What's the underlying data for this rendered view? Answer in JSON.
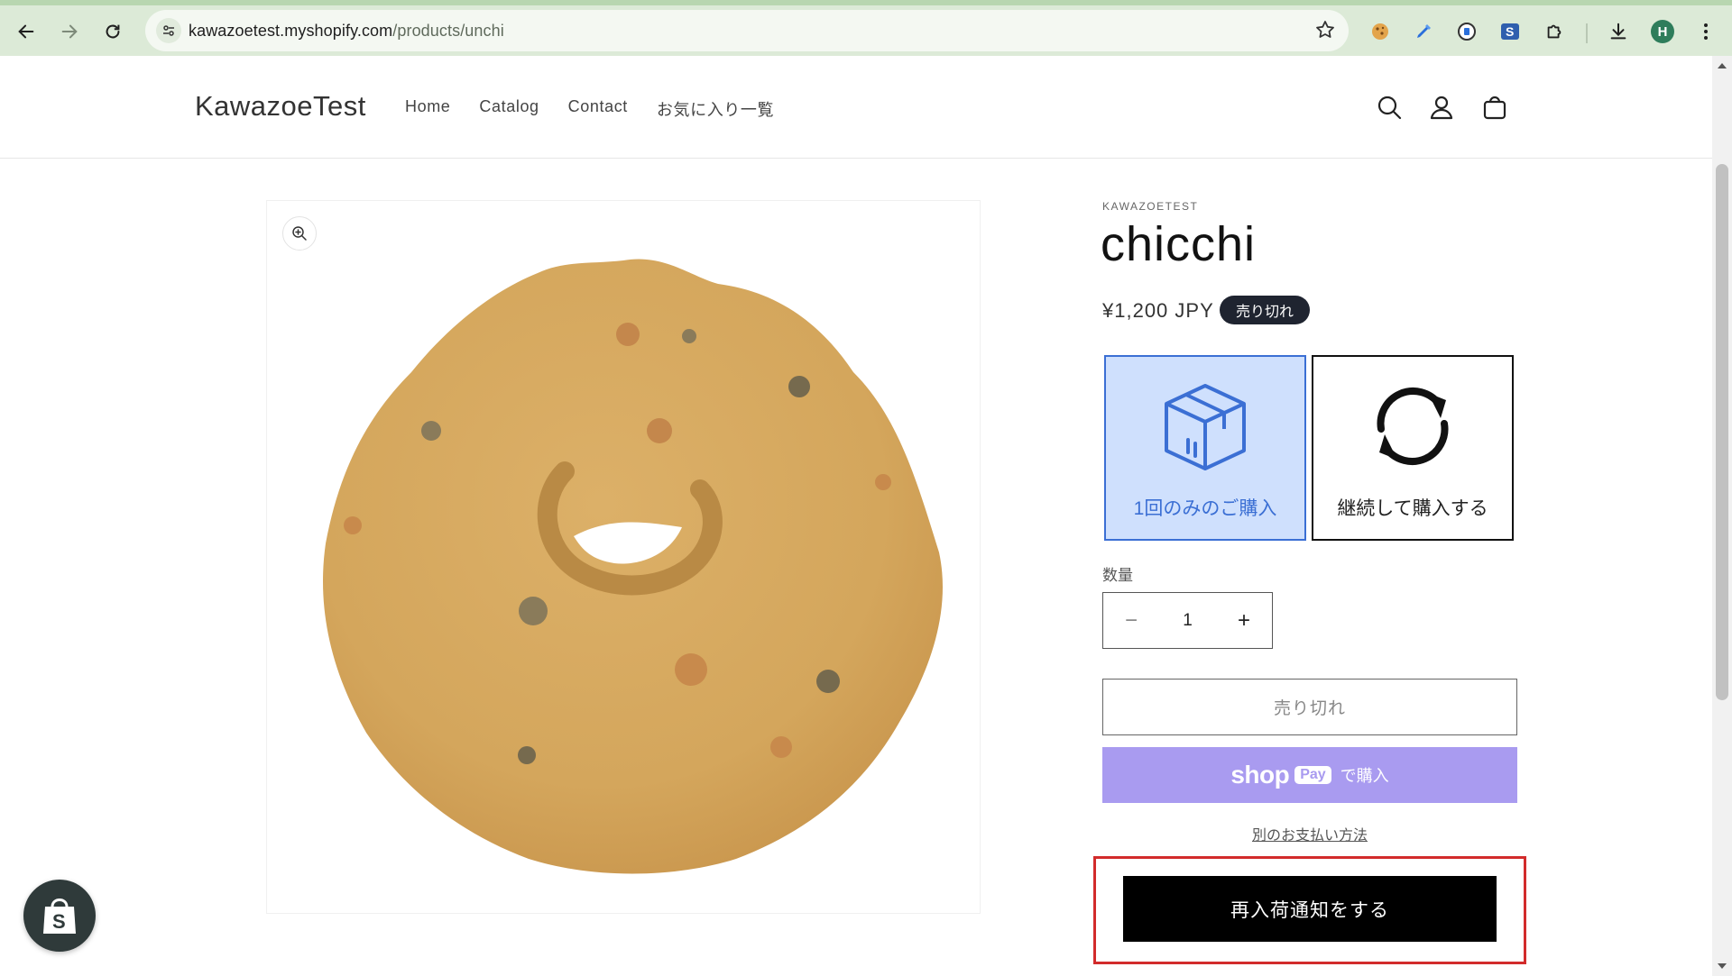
{
  "browser": {
    "url_host": "kawazoetest.myshopify.com",
    "url_path": "/products/unchi",
    "profile_initial": "H"
  },
  "store": {
    "logo": "KawazoeTest",
    "menu": [
      "Home",
      "Catalog",
      "Contact",
      "お気に入り一覧"
    ]
  },
  "product": {
    "vendor": "KAWAZOETEST",
    "title": "chicchi",
    "price": "¥1,200 JPY",
    "badge": "売り切れ",
    "plans": [
      {
        "label": "1回のみのご購入",
        "selected": true
      },
      {
        "label": "継続して購入する",
        "selected": false
      }
    ],
    "quantity_label": "数量",
    "quantity_value": "1",
    "soldout_button": "売り切れ",
    "shoppay": {
      "shop": "shop",
      "pay": "Pay",
      "buy": "で購入"
    },
    "other_payment": "別のお支払い方法",
    "notify_button": "再入荷通知をする"
  },
  "colors": {
    "chrome": "#dcead7",
    "plan_selected_bg": "#cfe0fd",
    "plan_selected_border": "#3b6fd4",
    "shoppay": "#a99bf0",
    "highlight_frame": "#d22b2b"
  }
}
